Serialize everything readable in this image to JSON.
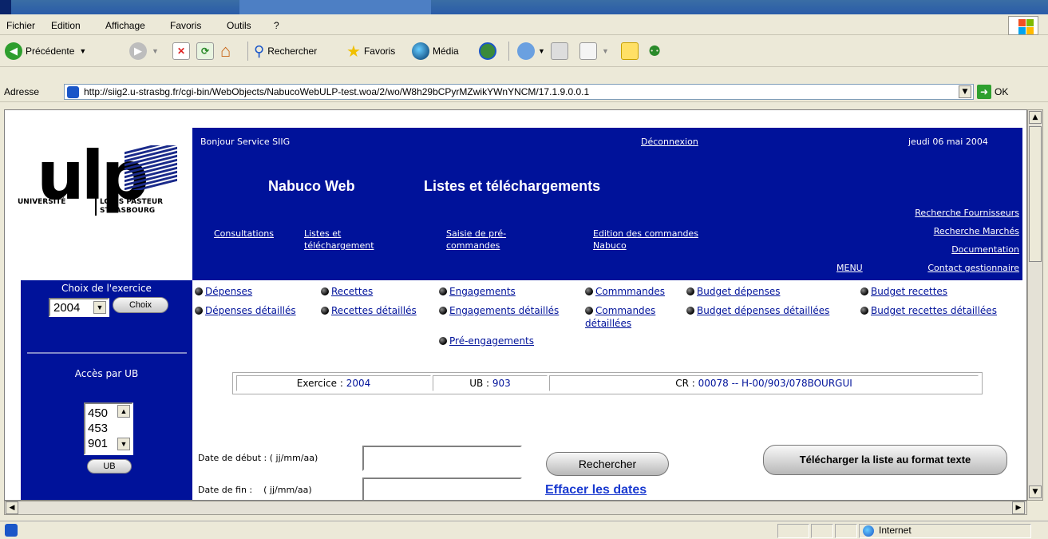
{
  "menu": {
    "items": [
      {
        "label": "Fichier"
      },
      {
        "label": "Edition"
      },
      {
        "label": "Affichage"
      },
      {
        "label": "Favoris"
      },
      {
        "label": "Outils"
      },
      {
        "label": "?"
      }
    ]
  },
  "toolbar": {
    "back_label": "Précédente",
    "search_label": "Rechercher",
    "favorites_label": "Favoris",
    "media_label": "Média"
  },
  "address": {
    "label": "Adresse",
    "url": "http://siig2.u-strasbg.fr/cgi-bin/WebObjects/NabucoWebULP-test.woa/2/wo/W8h29bCPyrMZwikYWnYNCM/17.1.9.0.0.1",
    "go_label": "OK"
  },
  "logo": {
    "mark": "ulp",
    "universite": "UNIVERSITÉ",
    "louis_pasteur": "LOUIS PASTEUR",
    "strasbourg": "STRASBOURG"
  },
  "header": {
    "greeting": "Bonjour  Service SIIG",
    "logout": "Déconnexion",
    "date": "jeudi 06 mai 2004",
    "app_name": "Nabuco Web",
    "page_title": "Listes et téléchargements",
    "nav": [
      {
        "label": "Consultations"
      },
      {
        "label": "Listes et"
      },
      {
        "label": "téléchargement"
      },
      {
        "label": "Saisie de pré-"
      },
      {
        "label": "commandes"
      },
      {
        "label": "Edition des commandes"
      },
      {
        "label": "Nabuco"
      }
    ],
    "right_links": [
      {
        "label": "Recherche Fournisseurs"
      },
      {
        "label": "Recherche Marchés"
      },
      {
        "label": "Documentation"
      },
      {
        "label": "Contact gestionnaire"
      }
    ],
    "menu_label": "MENU"
  },
  "sidebar": {
    "exercice_title": "Choix de l'exercice",
    "exercice_value": "2004",
    "choix_button": "Choix",
    "ub_title": "Accès par UB",
    "ub_options": [
      "450",
      "453",
      "901"
    ],
    "ub_button": "UB"
  },
  "links": {
    "row1": [
      "Dépenses",
      "Recettes",
      "Engagements",
      "Commmandes",
      "Budget dépenses",
      "Budget recettes"
    ],
    "row2": [
      "Dépenses détaillés",
      "Recettes détaillés",
      "Engagements détaillés",
      "Commandes",
      "Budget dépenses détaillées",
      "Budget recettes détaillées"
    ],
    "row2_extra": "détaillées",
    "row3": "Pré-engagements"
  },
  "info": {
    "exercice_label": "Exercice : ",
    "exercice_value": "2004",
    "ub_label": "UB : ",
    "ub_value": "903",
    "cr_label": "CR : ",
    "cr_value": "00078 -- H-00/903/078BOURGUI"
  },
  "form": {
    "start_label": "Date de début : ( jj/mm/aa)",
    "start_value": "",
    "end_label": "Date de fin :    ( jj/mm/aa)",
    "end_value": "",
    "search_button": "Rechercher",
    "clear_link": "Effacer les dates",
    "download_button": "Télécharger la liste au format texte"
  },
  "status": {
    "zone": "Internet"
  }
}
